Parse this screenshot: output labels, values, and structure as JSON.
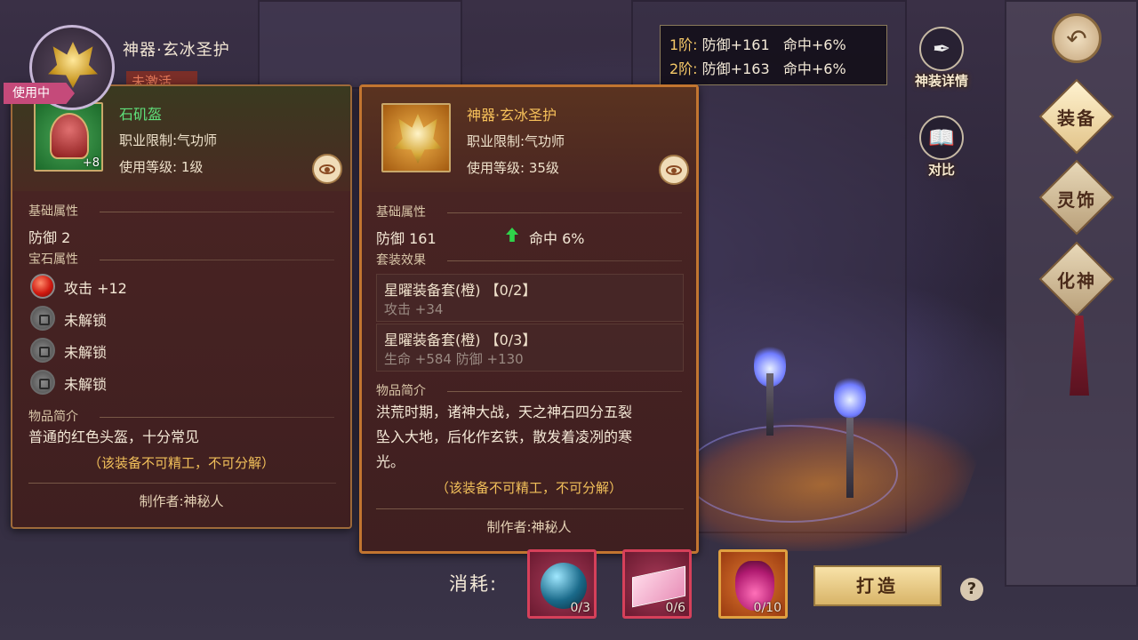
{
  "header": {
    "title": "神器·玄冰圣护",
    "status": "未激活"
  },
  "tiers": [
    {
      "level": "1阶:",
      "defense": "防御+161",
      "hit": "命中+6%"
    },
    {
      "level": "2阶:",
      "defense": "防御+163",
      "hit": "命中+6%"
    }
  ],
  "side": {
    "detail_label": "神装详情",
    "compare_label": "对比",
    "tabs": [
      "装备",
      "灵饰",
      "化神"
    ]
  },
  "left_card": {
    "tag": "使用中",
    "name": "石矶盔",
    "plus": "+8",
    "job": "职业限制:气功师",
    "level": "使用等级: 1级",
    "base_title": "基础属性",
    "base_attr": "防御  2",
    "gem_title": "宝石属性",
    "gems": [
      "攻击  +12",
      "未解锁",
      "未解锁",
      "未解锁"
    ],
    "desc_title": "物品简介",
    "desc": "普通的红色头盔，十分常见",
    "note": "（该装备不可精工，不可分解）",
    "maker": "制作者:神秘人"
  },
  "right_card": {
    "name": "神器·玄冰圣护",
    "job": "职业限制:气功师",
    "level": "使用等级: 35级",
    "base_title": "基础属性",
    "defense": "防御  161",
    "hit": "命中   6%",
    "set_title": "套装效果",
    "sets": [
      {
        "title": "星曜装备套(橙)  【0/2】",
        "effect": "攻击 +34"
      },
      {
        "title": "星曜装备套(橙)  【0/3】",
        "effect": "生命 +584   防御 +130"
      }
    ],
    "desc_title": "物品简介",
    "desc": [
      "洪荒时期，诸神大战，天之神石四分五裂",
      "坠入大地，后化作玄铁，散发着凌冽的寒",
      "光。"
    ],
    "note": "（该装备不可精工，不可分解）",
    "maker": "制作者:神秘人"
  },
  "bottom": {
    "consume_label": "消耗:",
    "materials": [
      {
        "name": "orb",
        "count": "0/3"
      },
      {
        "name": "crystal",
        "count": "0/6"
      },
      {
        "name": "potion",
        "count": "0/10"
      }
    ],
    "forge_label": "打造",
    "help": "?"
  },
  "colors": {
    "green_name": "#5fe07a",
    "gold_name": "#f6c05a",
    "note": "#f2c05a"
  }
}
